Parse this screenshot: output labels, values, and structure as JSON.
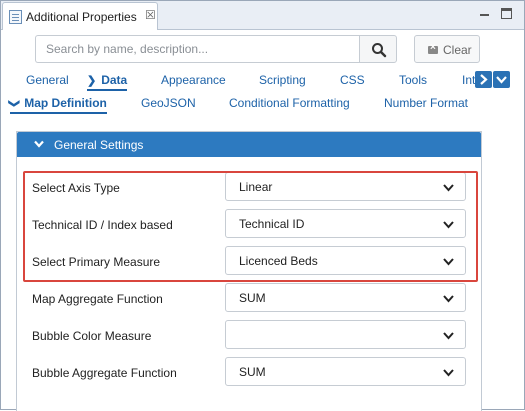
{
  "window": {
    "tab_title": "Additional Properties",
    "tab_close": "☒"
  },
  "search": {
    "placeholder": "Search by name, description...",
    "value": "",
    "clear_label": "Clear"
  },
  "tabs_primary": [
    {
      "label": "General",
      "active": false
    },
    {
      "label": "Data",
      "active": true
    },
    {
      "label": "Appearance",
      "active": false
    },
    {
      "label": "Scripting",
      "active": false
    },
    {
      "label": "CSS",
      "active": false
    },
    {
      "label": "Tools",
      "active": false
    },
    {
      "label": "Int",
      "active": false
    }
  ],
  "tabs_secondary": [
    {
      "label": "Map Definition",
      "active": true
    },
    {
      "label": "GeoJSON",
      "active": false
    },
    {
      "label": "Conditional Formatting",
      "active": false
    },
    {
      "label": "Number Format",
      "active": false
    }
  ],
  "panel": {
    "title": "General Settings",
    "fields": [
      {
        "label": "Select Axis Type",
        "value": "Linear"
      },
      {
        "label": "Technical ID / Index based",
        "value": "Technical ID"
      },
      {
        "label": "Select Primary Measure",
        "value": "Licenced Beds"
      },
      {
        "label": "Map Aggregate Function",
        "value": "SUM"
      },
      {
        "label": "Bubble Color Measure",
        "value": ""
      },
      {
        "label": "Bubble Aggregate Function",
        "value": "SUM"
      }
    ]
  },
  "colors": {
    "accent": "#2d7ac0",
    "link": "#1d62a8",
    "highlight": "#d9463d"
  },
  "icons": [
    "properties-icon",
    "search-icon",
    "clear-icon",
    "chevron-right-icon",
    "chevron-down-icon"
  ]
}
